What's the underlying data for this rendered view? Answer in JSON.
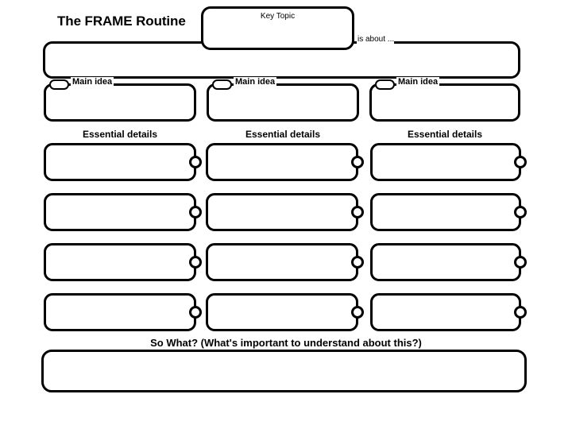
{
  "page": {
    "title": "The FRAME Routine",
    "background_color": "#ffffff",
    "line_color": "#000000"
  },
  "header": {
    "routine_title": "The FRAME Routine",
    "key_topic_label": "Key Topic",
    "is_about_label": "is about ...",
    "key_topic_value": "",
    "is_about_value": ""
  },
  "columns": [
    {
      "main_idea_label": "Main idea",
      "main_idea_value": "",
      "details_heading": "Essential details",
      "details": [
        "",
        "",
        "",
        ""
      ]
    },
    {
      "main_idea_label": "Main idea",
      "main_idea_value": "",
      "details_heading": "Essential details",
      "details": [
        "",
        "",
        "",
        ""
      ]
    },
    {
      "main_idea_label": "Main idea",
      "main_idea_value": "",
      "details_heading": "Essential details",
      "details": [
        "",
        "",
        "",
        ""
      ]
    }
  ],
  "footer": {
    "so_what_label": "So What? (What's important to understand about this?)",
    "so_what_value": ""
  }
}
